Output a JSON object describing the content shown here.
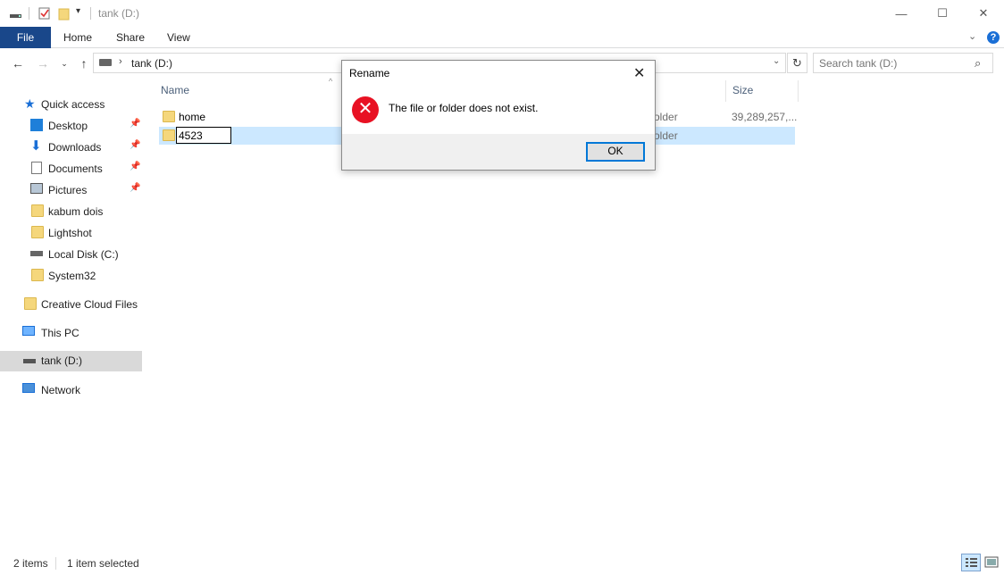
{
  "window": {
    "title": "tank (D:)",
    "controls": {
      "minimize": "—",
      "maximize": "☐",
      "close": "✕"
    }
  },
  "ribbon": {
    "tabs": [
      "File",
      "Home",
      "Share",
      "View"
    ],
    "help": "?"
  },
  "address": {
    "path": "tank (D:)",
    "separator": "›",
    "search_placeholder": "Search tank (D:)"
  },
  "nav": {
    "quick_access": "Quick access",
    "items": [
      {
        "label": "Desktop",
        "pinned": true
      },
      {
        "label": "Downloads",
        "pinned": true
      },
      {
        "label": "Documents",
        "pinned": true
      },
      {
        "label": "Pictures",
        "pinned": true
      },
      {
        "label": "kabum dois",
        "pinned": false
      },
      {
        "label": "Lightshot",
        "pinned": false
      },
      {
        "label": "Local Disk (C:)",
        "pinned": false
      },
      {
        "label": "System32",
        "pinned": false
      }
    ],
    "creative_cloud": "Creative Cloud Files",
    "this_pc": "This PC",
    "tank": "tank (D:)",
    "network": "Network"
  },
  "content": {
    "columns": {
      "name": "Name",
      "size": "Size"
    },
    "rows": [
      {
        "name": "home",
        "type": "older",
        "size": "39,289,257,..."
      },
      {
        "name": "4523",
        "type": "older",
        "size": ""
      }
    ]
  },
  "dialog": {
    "title": "Rename",
    "message": "The file or folder does not exist.",
    "ok": "OK",
    "close": "✕"
  },
  "status": {
    "count": "2 items",
    "selected": "1 item selected"
  },
  "colors": {
    "file_tab": "#19478a",
    "selection": "#cce8ff",
    "error": "#e81123",
    "focus": "#0078d7"
  }
}
